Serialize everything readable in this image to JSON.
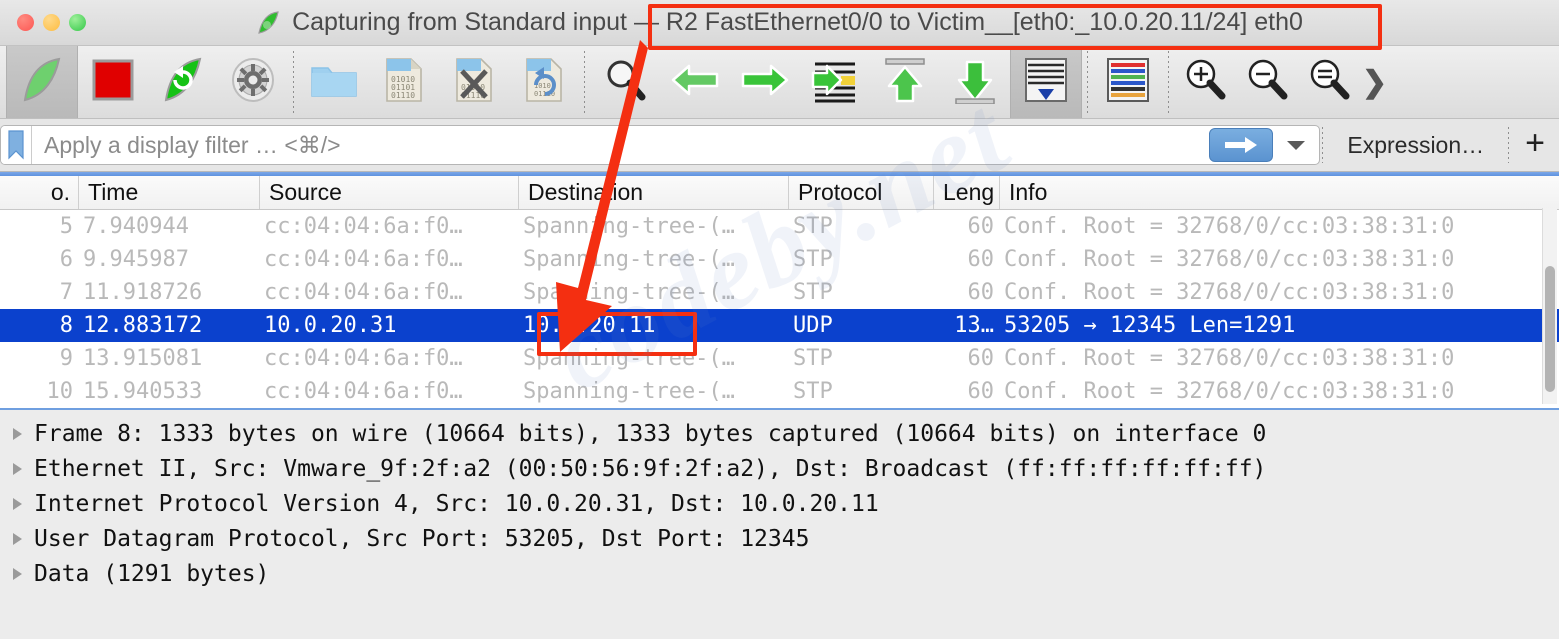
{
  "window": {
    "app_icon": "wireshark-fin-icon",
    "title_prefix": "Capturing from Standard input — ",
    "title_highlight": "R2 FastEthernet0/0 to Victim__[eth0:_10.0.20.11/24] eth0",
    "full_title": "Capturing from Standard input — R2 FastEthernet0/0 to Victim__[eth0:_10.0.20.11/24] eth0",
    "traffic_lights": [
      "close-button",
      "minimize-button",
      "maximize-button"
    ]
  },
  "toolbar": {
    "items": [
      {
        "name": "start-capture-button",
        "icon": "green-shark-fin-icon",
        "tooltip": "Start capturing packets"
      },
      {
        "name": "stop-capture-button",
        "icon": "red-square-icon",
        "tooltip": "Stop capturing packets"
      },
      {
        "name": "restart-capture-button",
        "icon": "green-fin-restart-icon",
        "tooltip": "Restart current capture"
      },
      {
        "name": "capture-options-button",
        "icon": "gear-icon",
        "tooltip": "Capture options"
      },
      {
        "name": "open-file-button",
        "icon": "folder-icon",
        "tooltip": "Open"
      },
      {
        "name": "save-file-button",
        "icon": "save-file-icon",
        "tooltip": "Save this capture file"
      },
      {
        "name": "close-file-button",
        "icon": "close-file-x-icon",
        "tooltip": "Close this capture file"
      },
      {
        "name": "reload-file-button",
        "icon": "reload-file-icon",
        "tooltip": "Reload this file"
      },
      {
        "name": "find-packet-button",
        "icon": "magnifier-icon",
        "tooltip": "Find a packet"
      },
      {
        "name": "go-back-button",
        "icon": "green-left-arrow-icon",
        "tooltip": "Go back in packet history"
      },
      {
        "name": "go-forward-button",
        "icon": "green-right-arrow-icon",
        "tooltip": "Go forward in packet history"
      },
      {
        "name": "go-to-packet-button",
        "icon": "go-to-packet-icon",
        "tooltip": "Go to specific packet"
      },
      {
        "name": "go-to-first-packet-button",
        "icon": "green-up-arrow-icon",
        "tooltip": "Go to the first packet"
      },
      {
        "name": "go-to-last-packet-button",
        "icon": "green-down-arrow-icon",
        "tooltip": "Go to the last packet"
      },
      {
        "name": "auto-scroll-button",
        "icon": "auto-scroll-icon",
        "tooltip": "Auto scroll in live capture",
        "pressed": true
      },
      {
        "name": "colorize-button",
        "icon": "colorize-packet-list-icon",
        "tooltip": "Colorize packet list"
      },
      {
        "name": "zoom-in-button",
        "icon": "zoom-in-icon",
        "tooltip": "Zoom in"
      },
      {
        "name": "zoom-out-button",
        "icon": "zoom-out-icon",
        "tooltip": "Zoom out"
      },
      {
        "name": "zoom-reset-button",
        "icon": "zoom-reset-icon",
        "tooltip": "Normal size"
      },
      {
        "name": "toolbar-overflow-button",
        "icon": "chevron-right-icon",
        "tooltip": "More"
      }
    ]
  },
  "filter_bar": {
    "bookmark_icon": "filter-bookmark-icon",
    "input_value": "",
    "placeholder": "Apply a display filter … <⌘/>",
    "apply_icon": "blue-right-arrow-icon",
    "dropdown_icon": "chevron-down-icon",
    "expression_label": "Expression…",
    "add_button_label": "+"
  },
  "packet_list": {
    "columns": [
      "o.",
      "Time",
      "Source",
      "Destination",
      "Protocol",
      "Leng",
      "Info"
    ],
    "rows": [
      {
        "no": "5",
        "time": "7.940944",
        "source": "cc:04:04:6a:f0…",
        "destination": "Spanning-tree-(…",
        "protocol": "STP",
        "length": "60",
        "info": "Conf. Root = 32768/0/cc:03:38:31:0",
        "selected": false
      },
      {
        "no": "6",
        "time": "9.945987",
        "source": "cc:04:04:6a:f0…",
        "destination": "Spanning-tree-(…",
        "protocol": "STP",
        "length": "60",
        "info": "Conf. Root = 32768/0/cc:03:38:31:0",
        "selected": false
      },
      {
        "no": "7",
        "time": "11.918726",
        "source": "cc:04:04:6a:f0…",
        "destination": "Spanning-tree-(…",
        "protocol": "STP",
        "length": "60",
        "info": "Conf. Root = 32768/0/cc:03:38:31:0",
        "selected": false
      },
      {
        "no": "8",
        "time": "12.883172",
        "source": "10.0.20.31",
        "destination": "10.0.20.11",
        "protocol": "UDP",
        "length": "13…",
        "info": "53205 → 12345 Len=1291",
        "selected": true
      },
      {
        "no": "9",
        "time": "13.915081",
        "source": "cc:04:04:6a:f0…",
        "destination": "Spanning-tree-(…",
        "protocol": "STP",
        "length": "60",
        "info": "Conf. Root = 32768/0/cc:03:38:31:0",
        "selected": false
      },
      {
        "no": "10",
        "time": "15.940533",
        "source": "cc:04:04:6a:f0…",
        "destination": "Spanning-tree-(…",
        "protocol": "STP",
        "length": "60",
        "info": "Conf. Root = 32768/0/cc:03:38:31:0",
        "selected": false
      }
    ],
    "scrollbar": "vertical-scrollbar"
  },
  "detail_pane": {
    "lines": [
      {
        "text": "Frame 8: 1333 bytes on wire (10664 bits), 1333 bytes captured (10664 bits) on interface 0",
        "expanded": false
      },
      {
        "text": "Ethernet II, Src: Vmware_9f:2f:a2 (00:50:56:9f:2f:a2), Dst: Broadcast (ff:ff:ff:ff:ff:ff)",
        "expanded": false
      },
      {
        "text": "Internet Protocol Version 4, Src: 10.0.20.31, Dst: 10.0.20.11",
        "expanded": false
      },
      {
        "text": "User Datagram Protocol, Src Port: 53205, Dst Port: 12345",
        "expanded": false
      },
      {
        "text": "Data (1291 bytes)",
        "expanded": false
      }
    ]
  },
  "annotations": {
    "highlight_color": "#f42f11",
    "title_box_target": "R2 FastEthernet0/0 to Victim__[eth0:_10.0.20.11/24] eth0",
    "ip_box_target": "10.0.20.31   10.0.20.11",
    "arrow": "red-down-arrow-annotation"
  },
  "watermark": {
    "text": "codeby.net"
  },
  "colors": {
    "selection_blue": "#0b41cd",
    "annotation_red": "#f42f11",
    "wireshark_green": "#18b318"
  }
}
